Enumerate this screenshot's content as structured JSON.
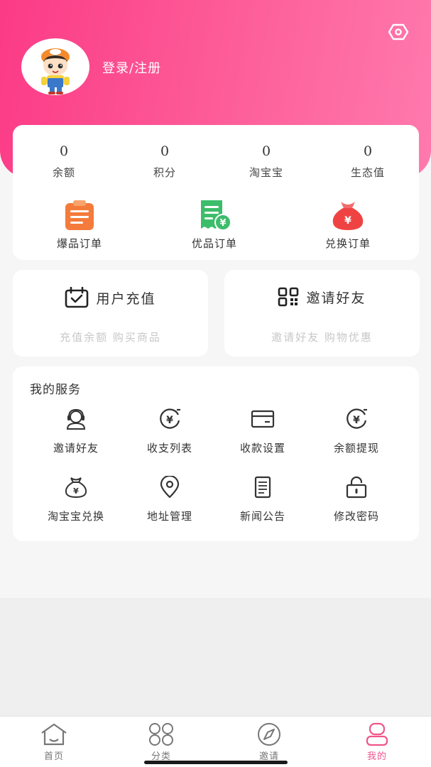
{
  "colors": {
    "brand": "#fc3a86",
    "brand_light": "#ff7aae",
    "orange": "#f47b3b",
    "green": "#3cbd6a",
    "red": "#ef4343",
    "tab_active": "#f0558c"
  },
  "header": {
    "login_label": "登录/注册",
    "settings_icon": "settings-icon",
    "avatar_icon": "avatar-cartoon-boy"
  },
  "stats": [
    {
      "value": "0",
      "label": "余额"
    },
    {
      "value": "0",
      "label": "积分"
    },
    {
      "value": "0",
      "label": "淘宝宝"
    },
    {
      "value": "0",
      "label": "生态值"
    }
  ],
  "orders": [
    {
      "label": "爆品订单",
      "icon": "clipboard-icon"
    },
    {
      "label": "优品订单",
      "icon": "receipt-yen-icon"
    },
    {
      "label": "兑换订单",
      "icon": "money-bag-icon"
    }
  ],
  "recharge": {
    "title": "用户充值",
    "subtitle": "充值余额 购买商品",
    "icon": "calendar-check-icon"
  },
  "invite": {
    "title": "邀请好友",
    "subtitle": "邀请好友 购物优惠",
    "icon": "qrcode-icon"
  },
  "services": {
    "title": "我的服务",
    "items": [
      {
        "label": "邀请好友",
        "icon": "headset-user-icon"
      },
      {
        "label": "收支列表",
        "icon": "yen-coin-icon"
      },
      {
        "label": "收款设置",
        "icon": "card-icon"
      },
      {
        "label": "余额提现",
        "icon": "yen-coin-icon"
      },
      {
        "label": "淘宝宝兑换",
        "icon": "yen-bag-icon"
      },
      {
        "label": "地址管理",
        "icon": "location-pin-icon"
      },
      {
        "label": "新闻公告",
        "icon": "document-icon"
      },
      {
        "label": "修改密码",
        "icon": "lock-icon"
      }
    ]
  },
  "tabbar": [
    {
      "label": "首页",
      "icon": "home-icon",
      "active": false
    },
    {
      "label": "分类",
      "icon": "category-icon",
      "active": false
    },
    {
      "label": "邀请",
      "icon": "compass-icon",
      "active": false
    },
    {
      "label": "我的",
      "icon": "user-icon",
      "active": true
    }
  ]
}
